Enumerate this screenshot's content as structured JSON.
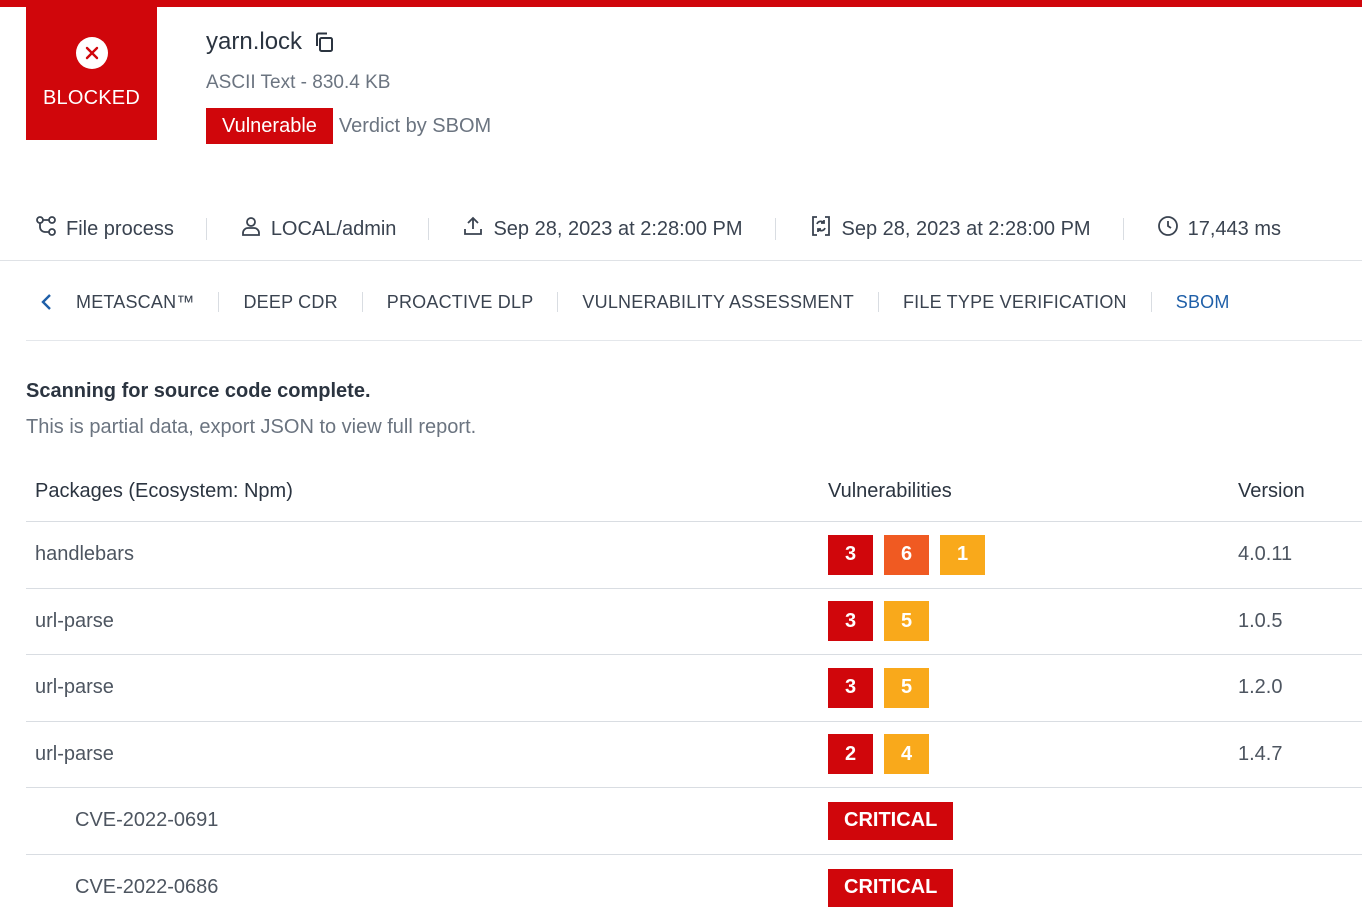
{
  "colors": {
    "brand_red": "#d0060b",
    "high_orange": "#f05a22",
    "medium_amber": "#f9a91b",
    "active_tab": "#1f5fa8"
  },
  "status": {
    "label": "BLOCKED",
    "icon": "x-circle-icon"
  },
  "file": {
    "name": "yarn.lock",
    "meta": "ASCII Text - 830.4 KB",
    "verdict_badge": "Vulnerable",
    "verdict_text": "Verdict by SBOM"
  },
  "info": {
    "process": "File process",
    "user": "LOCAL/admin",
    "uploaded": "Sep 28, 2023 at 2:28:00 PM",
    "processed": "Sep 28, 2023 at 2:28:00 PM",
    "duration": "17,443 ms"
  },
  "tabs": [
    "METASCAN™",
    "DEEP CDR",
    "PROACTIVE DLP",
    "VULNERABILITY ASSESSMENT",
    "FILE TYPE VERIFICATION",
    "SBOM"
  ],
  "active_tab": "SBOM",
  "scan": {
    "title": "Scanning for source code complete.",
    "subtitle": "This is partial data, export JSON to view full report."
  },
  "table": {
    "headers": {
      "package": "Packages (Ecosystem: Npm)",
      "vulnerabilities": "Vulnerabilities",
      "version": "Version"
    },
    "rows": [
      {
        "package": "handlebars",
        "counts": {
          "critical": "3",
          "high": "6",
          "medium": "1"
        },
        "version": "4.0.11"
      },
      {
        "package": "url-parse",
        "counts": {
          "critical": "3",
          "medium": "5"
        },
        "version": "1.0.5"
      },
      {
        "package": "url-parse",
        "counts": {
          "critical": "3",
          "medium": "5"
        },
        "version": "1.2.0"
      },
      {
        "package": "url-parse",
        "counts": {
          "critical": "2",
          "medium": "4"
        },
        "version": "1.4.7"
      },
      {
        "cve": "CVE-2022-0691",
        "severity": "CRITICAL"
      },
      {
        "cve": "CVE-2022-0686",
        "severity": "CRITICAL"
      }
    ]
  }
}
